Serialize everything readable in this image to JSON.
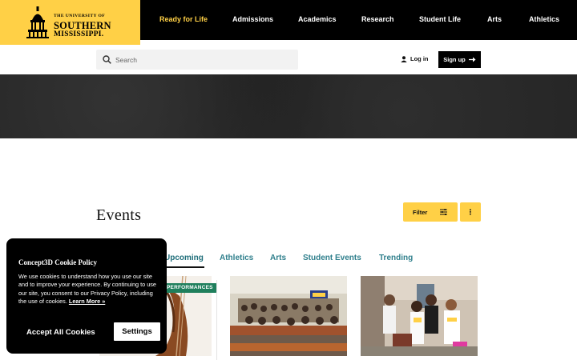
{
  "logo": {
    "line1": "THE UNIVERSITY OF",
    "line2": "SOUTHERN",
    "line3": "MISSISSIPPI."
  },
  "nav": {
    "items": [
      {
        "label": "Ready for Life",
        "active": true
      },
      {
        "label": "Admissions",
        "active": false
      },
      {
        "label": "Academics",
        "active": false
      },
      {
        "label": "Research",
        "active": false
      },
      {
        "label": "Student Life",
        "active": false
      },
      {
        "label": "Arts",
        "active": false
      },
      {
        "label": "Athletics",
        "active": false
      }
    ]
  },
  "search": {
    "placeholder": "Search",
    "value": ""
  },
  "account": {
    "login_label": "Log in",
    "signup_label": "Sign up"
  },
  "events": {
    "title": "Events",
    "filter_label": "Filter",
    "more_label": "⋮",
    "tabs": [
      {
        "label": "Upcoming",
        "active": true
      },
      {
        "label": "Athletics",
        "active": false
      },
      {
        "label": "Arts",
        "active": false
      },
      {
        "label": "Student Events",
        "active": false
      },
      {
        "label": "Trending",
        "active": false
      }
    ],
    "cards": [
      {
        "badge": "PERFORMANCES"
      },
      {
        "badge": ""
      },
      {
        "badge": ""
      }
    ]
  },
  "cookie": {
    "title": "Concept3D Cookie Policy",
    "body": "We use cookies to understand how you use our site and to improve your experience. By continuing to use our site, you consent to our Privacy Policy, including the use of cookies.",
    "link": "Learn More »",
    "accept_label": "Accept All Cookies",
    "settings_label": "Settings"
  },
  "colors": {
    "brand_gold": "#ffd046",
    "nav_bg": "#000000",
    "tab_teal": "#2f7f8c",
    "badge_green": "#1f7f5c"
  },
  "icons": {
    "search": "search-icon",
    "user": "user-icon",
    "arrow": "arrow-right-icon",
    "filter": "sliders-icon",
    "more": "more-vertical-icon",
    "logo": "dome-icon"
  }
}
